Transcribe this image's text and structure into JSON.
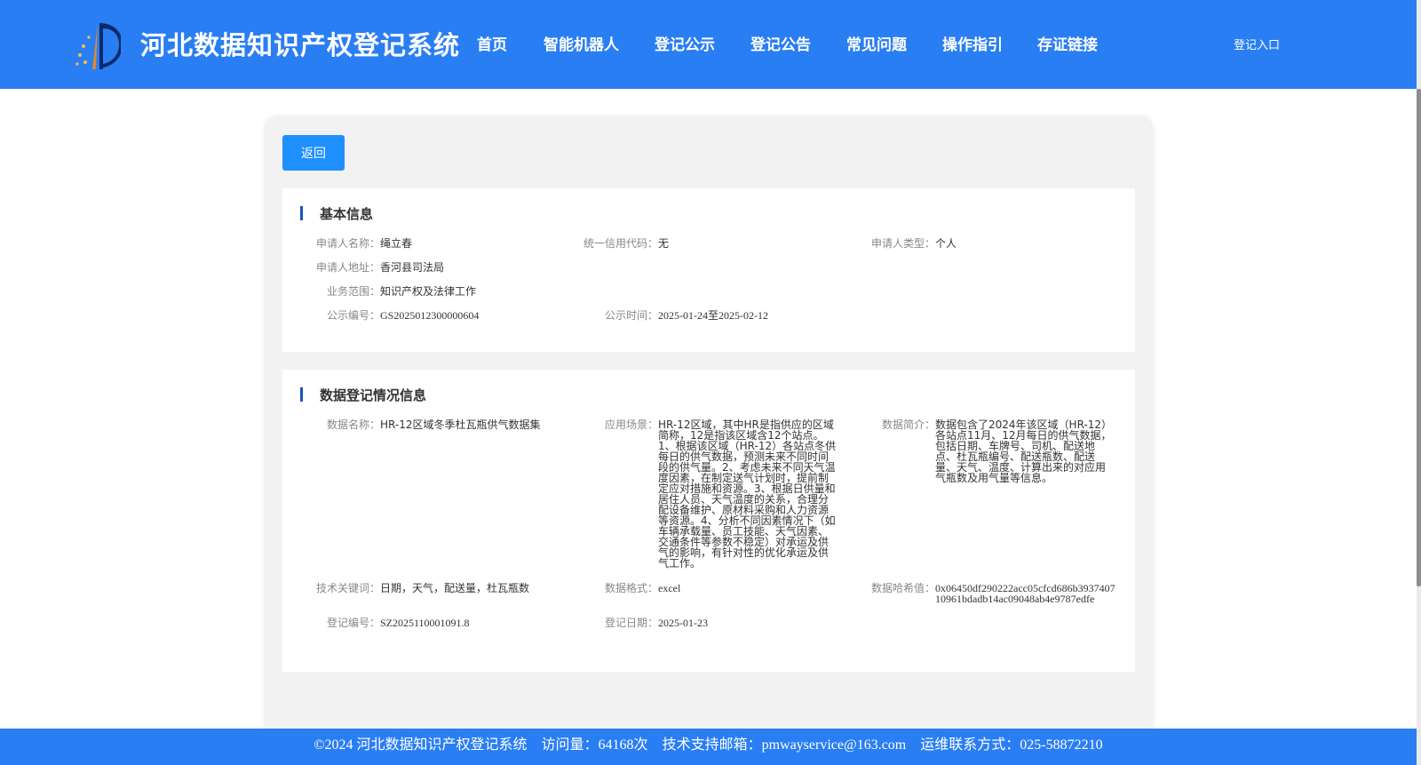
{
  "header": {
    "site_title": "河北数据知识产权登记系统",
    "nav": [
      "首页",
      "智能机器人",
      "登记公示",
      "登记公告",
      "常见问题",
      "操作指引",
      "存证链接"
    ],
    "login": "登记入口"
  },
  "back_label": "返回",
  "basic": {
    "title": "基本信息",
    "applicant_name_label": "申请人名称：",
    "applicant_name": "绳立春",
    "credit_code_label": "统一信用代码：",
    "credit_code": "无",
    "applicant_type_label": "申请人类型：",
    "applicant_type": "个人",
    "address_label": "申请人地址：",
    "address": "香河县司法局",
    "scope_label": "业务范围：",
    "scope": "知识产权及法律工作",
    "pub_no_label": "公示编号：",
    "pub_no": "GS2025012300000604",
    "pub_time_label": "公示时间：",
    "pub_time": "2025-01-24至2025-02-12"
  },
  "registration": {
    "title": "数据登记情况信息",
    "data_name_label": "数据名称：",
    "data_name": "HR-12区域冬季杜瓦瓶供气数据集",
    "scene_label": "应用场景：",
    "scene": "HR-12区域，其中HR是指供应的区域简称，12是指该区域含12个站点。1、根据该区域（HR-12）各站点冬供每日的供气数据，预测未来不同时间段的供气量。2、考虑未来不同天气温度因素，在制定送气计划时，提前制定应对措施和资源。3、根据日供量和居住人员、天气温度的关系，合理分配设备维护、原材料采购和人力资源等资源。4、分析不同因素情况下（如车辆承载量、员工技能、天气因素、交通条件等参数不稳定）对承运及供气的影响，有针对性的优化承运及供气工作。",
    "intro_label": "数据简介：",
    "intro": "数据包含了2024年该区域（HR-12）各站点11月、12月每日的供气数据，包括日期、车牌号、司机、配送地点、杜瓦瓶编号、配送瓶数、配送量、天气、温度、计算出来的对应用气瓶数及用气量等信息。",
    "keywords_label": "技术关键词：",
    "keywords": "日期，天气，配送量，杜瓦瓶数",
    "format_label": "数据格式：",
    "format": "excel",
    "hash_label": "数据哈希值：",
    "hash": "0x06450df290222acc05cfcd686b393740710961bdadb14ac09048ab4e9787edfe",
    "reg_no_label": "登记编号：",
    "reg_no": "SZ2025110001091.8",
    "reg_date_label": "登记日期：",
    "reg_date": "2025-01-23"
  },
  "footer": {
    "copyright": "©2024 河北数据知识产权登记系统",
    "visits": "访问量：64168次",
    "email": "技术支持邮箱：pmwayservice@163.com",
    "contact": "运维联系方式：025-58872210"
  }
}
